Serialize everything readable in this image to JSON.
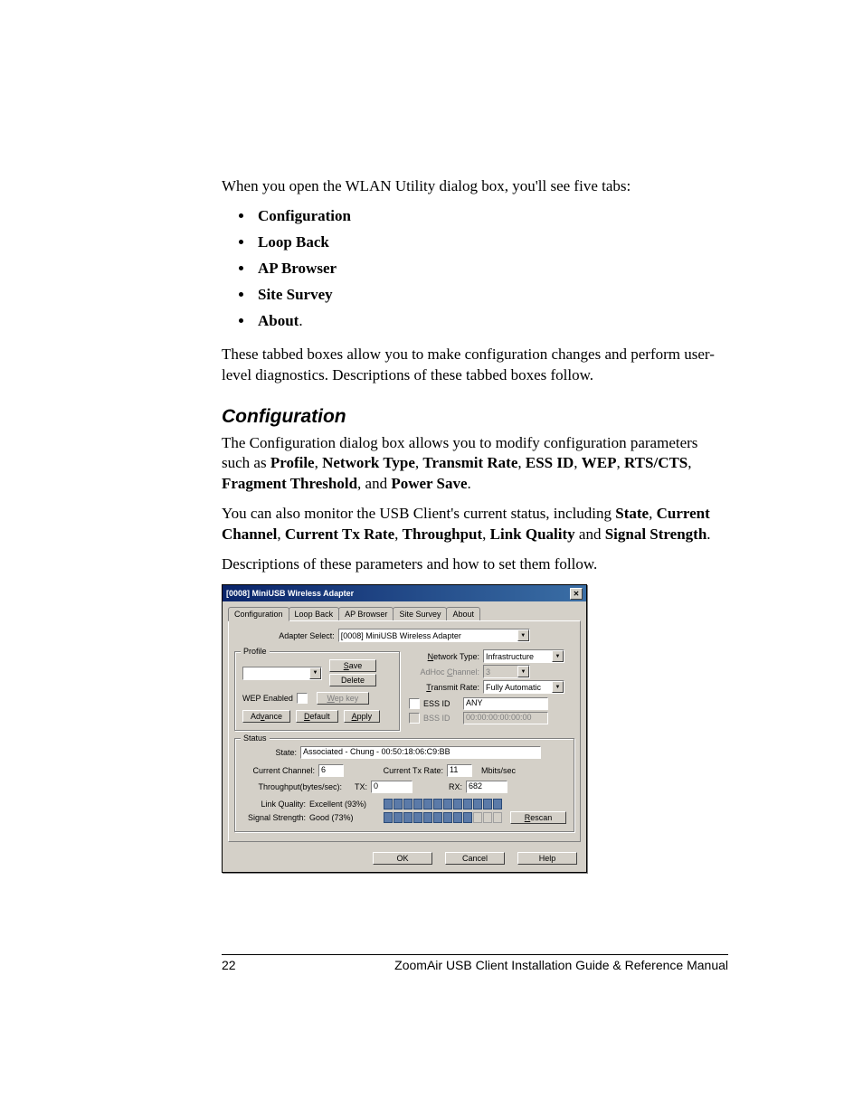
{
  "intro": "When you open the WLAN Utility dialog box, you'll see five tabs:",
  "tabs": [
    "Configuration",
    "Loop Back",
    "AP Browser",
    "Site Survey",
    "About"
  ],
  "after_tabs": "These tabbed boxes allow you to make configuration changes and perform user-level diagnostics. Descriptions of these tabbed boxes follow.",
  "section_heading": "Configuration",
  "config_p1a": "The Configuration dialog box allows you to modify configuration parameters such as ",
  "config_p1_terms": [
    "Profile",
    "Network Type",
    "Transmit Rate",
    "ESS ID",
    "WEP",
    "RTS/CTS",
    "Fragment Threshold",
    "Power Save"
  ],
  "config_p2a": "You can also monitor the USB Client's current status, including ",
  "config_p2_terms": [
    "State",
    "Current Channel",
    "Current Tx Rate",
    "Throughput",
    "Link Quality",
    "Signal Strength"
  ],
  "config_p3": "Descriptions of these parameters and how to set them follow.",
  "dialog": {
    "title": "[0008] MiniUSB Wireless Adapter",
    "tabs": [
      "Configuration",
      "Loop Back",
      "AP Browser",
      "Site Survey",
      "About"
    ],
    "adapter_select_label": "Adapter Select:",
    "adapter_select_value": "[0008] MiniUSB Wireless Adapter",
    "profile_legend": "Profile",
    "save_btn": "Save",
    "delete_btn": "Delete",
    "wep_label": "WEP Enabled",
    "wepkey_btn": "Wep key",
    "advance_btn": "Advance",
    "default_btn": "Default",
    "apply_btn": "Apply",
    "network_type_label": "Network Type:",
    "network_type_value": "Infrastructure",
    "adhoc_label": "AdHoc Channel:",
    "adhoc_value": "3",
    "txrate_label": "Transmit Rate:",
    "txrate_value": "Fully Automatic",
    "essid_chk": "ESS ID",
    "essid_val": "ANY",
    "bssid_chk": "BSS ID",
    "bssid_val": "00:00:00:00:00:00",
    "status_legend": "Status",
    "state_label": "State:",
    "state_value": "Associated - Chung - 00:50:18:06:C9:BB",
    "curch_label": "Current Channel:",
    "curch_value": "6",
    "curtx_label": "Current Tx Rate:",
    "curtx_value": "11",
    "curtx_unit": "Mbits/sec",
    "thru_label": "Throughput(bytes/sec):",
    "tx_label": "TX:",
    "tx_value": "0",
    "rx_label": "RX:",
    "rx_value": "682",
    "linkq_label": "Link Quality:",
    "linkq_value": "Excellent (93%)",
    "sigstr_label": "Signal Strength:",
    "sigstr_value": "Good (73%)",
    "rescan_btn": "Rescan",
    "ok_btn": "OK",
    "cancel_btn": "Cancel",
    "help_btn": "Help"
  },
  "footer": {
    "page": "22",
    "title": "ZoomAir USB Client Installation Guide & Reference Manual"
  }
}
